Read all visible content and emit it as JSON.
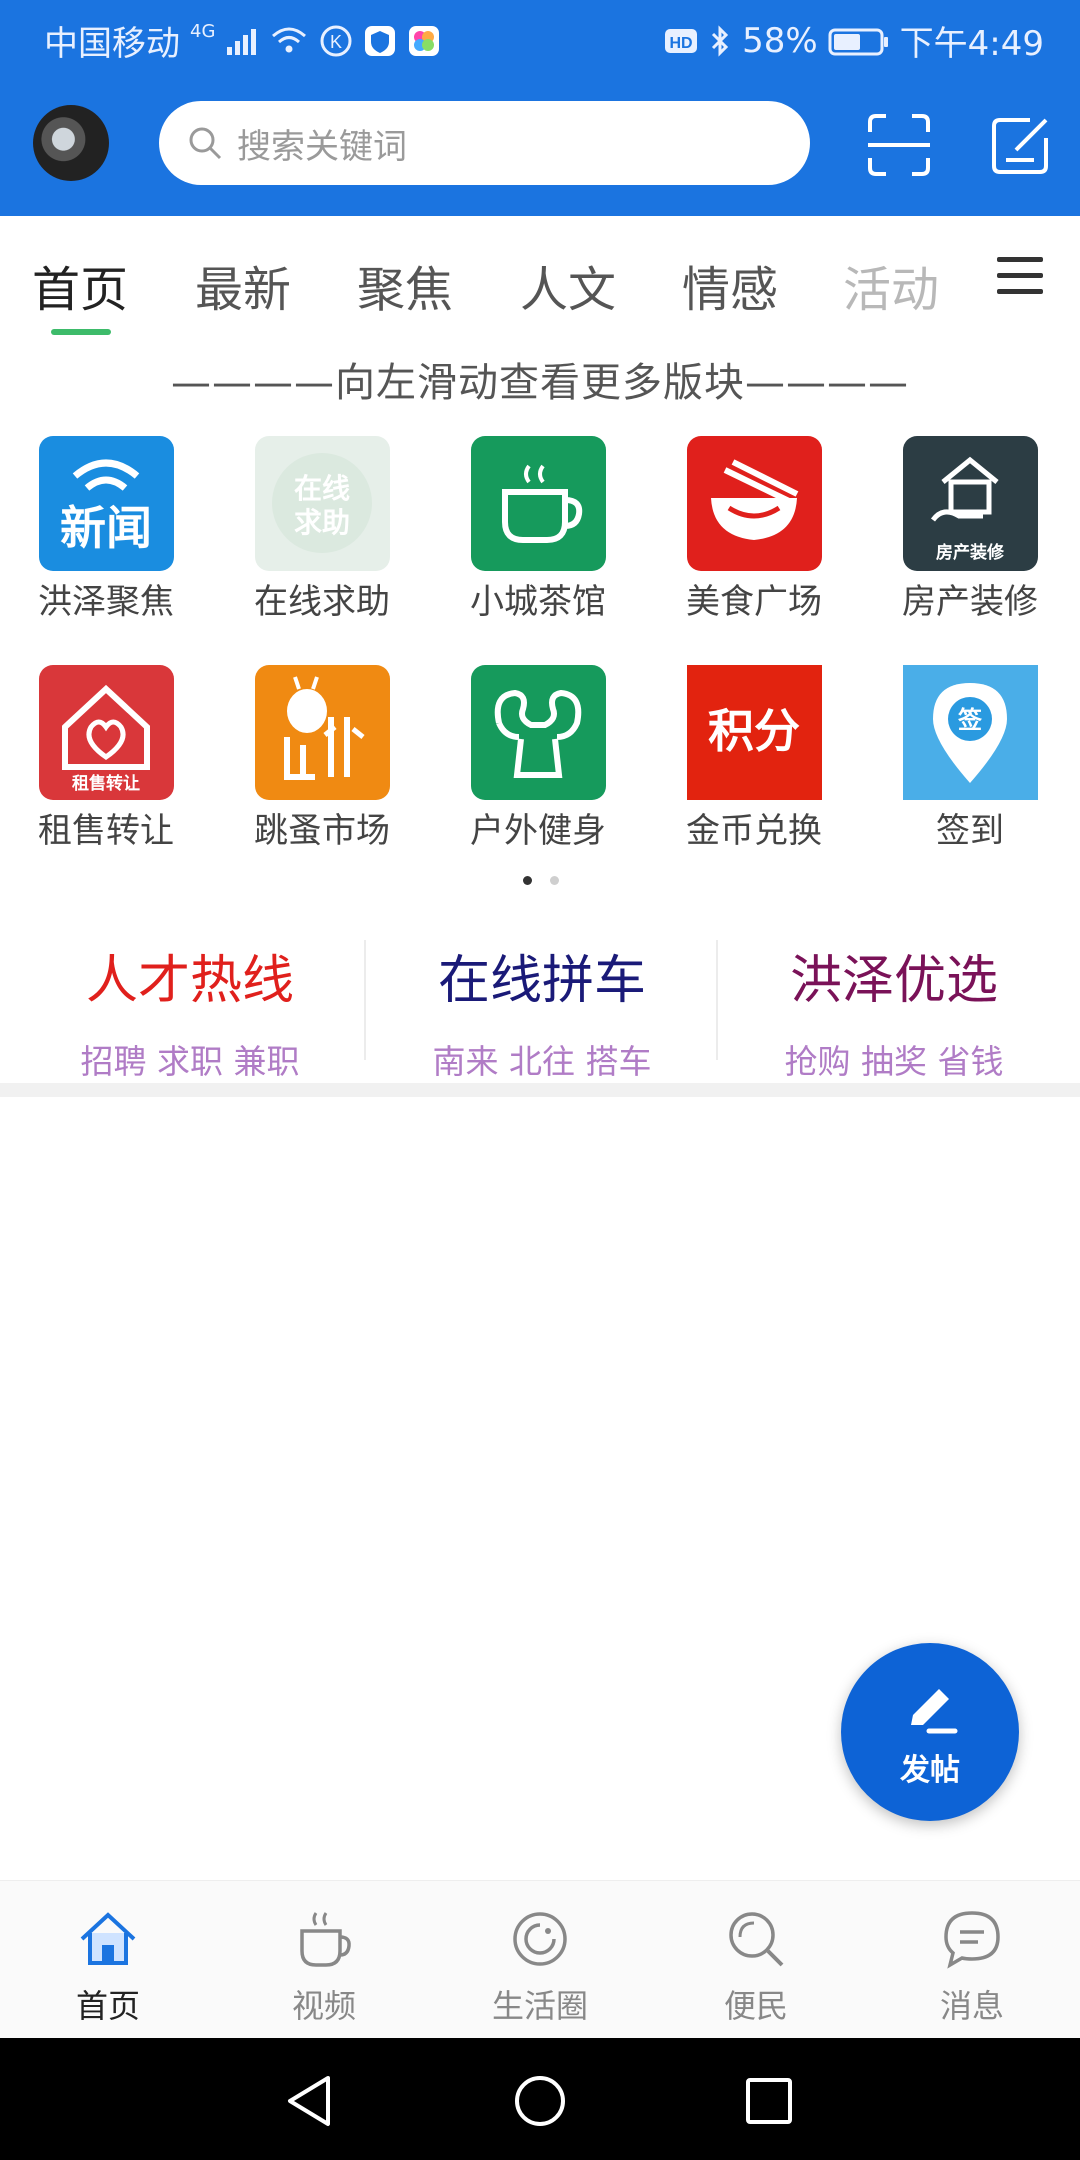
{
  "status_bar": {
    "carrier": "中国移动",
    "network": "4G",
    "battery": "58%",
    "time": "下午4:49"
  },
  "header": {
    "search_placeholder": "搜索关键词",
    "brand_color": "#1b74e0"
  },
  "tabs": [
    {
      "label": "首页",
      "active": true
    },
    {
      "label": "最新"
    },
    {
      "label": "聚焦"
    },
    {
      "label": "人文"
    },
    {
      "label": "情感"
    },
    {
      "label": "活动"
    }
  ],
  "swipe_hint": "————向左滑动查看更多版块————",
  "grid": [
    {
      "label": "洪泽聚焦",
      "icon": "news-icon"
    },
    {
      "label": "在线求助",
      "icon": "online-help-icon"
    },
    {
      "label": "小城茶馆",
      "icon": "tea-cup-icon"
    },
    {
      "label": "美食广场",
      "icon": "food-bowl-icon"
    },
    {
      "label": "房产装修",
      "icon": "house-renovation-icon",
      "badge": "房产装修"
    },
    {
      "label": "租售转让",
      "icon": "house-heart-icon",
      "badge": "租售转让"
    },
    {
      "label": "跳蚤市场",
      "icon": "flea-market-icon"
    },
    {
      "label": "户外健身",
      "icon": "fitness-muscle-icon"
    },
    {
      "label": "金币兑换",
      "icon": "points-icon",
      "badge": "积分"
    },
    {
      "label": "签到",
      "icon": "checkin-pin-icon",
      "badge": "签"
    }
  ],
  "grid_icon_texts": {
    "news": "新闻",
    "help": "在线求助"
  },
  "page_indicator": {
    "pages": 2,
    "current": 1
  },
  "promos": [
    {
      "title": "人才热线",
      "subtitle": "招聘 求职 兼职",
      "color": "#e0201c"
    },
    {
      "title": "在线拼车",
      "subtitle": "南来 北往  搭车",
      "color": "#1a1a78"
    },
    {
      "title": "洪泽优选",
      "subtitle": "抢购  抽奖  省钱",
      "color": "#7a1258"
    }
  ],
  "fab": {
    "label": "发帖"
  },
  "bottom_nav": [
    {
      "label": "首页",
      "icon": "home-icon",
      "active": true
    },
    {
      "label": "视频",
      "icon": "coffee-cup-icon"
    },
    {
      "label": "生活圈",
      "icon": "life-circle-icon"
    },
    {
      "label": "便民",
      "icon": "search-icon"
    },
    {
      "label": "消息",
      "icon": "message-icon"
    }
  ]
}
